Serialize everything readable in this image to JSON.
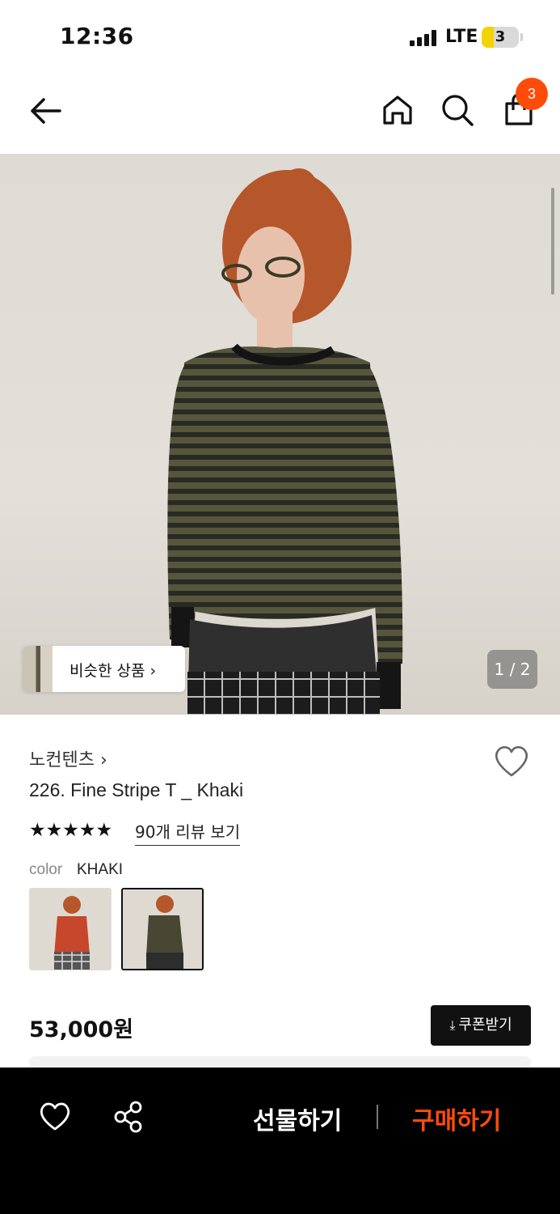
{
  "status_bar": {
    "time": "12:36",
    "network": "LTE",
    "battery": "3"
  },
  "header": {
    "icons": [
      "back-arrow-icon",
      "home-icon",
      "search-icon",
      "shopping-bag-icon"
    ],
    "cart_badge": "3",
    "accent_color": "#ff4b0a"
  },
  "gallery": {
    "similar_label": "비슷한 상품 ›",
    "page_indicator": "1 / 2"
  },
  "product": {
    "brand": "노컨텐츠 ›",
    "name": "226. Fine Stripe T _ Khaki",
    "rating_stars": "★★★★★",
    "review_link": "90개 리뷰 보기",
    "color_label": "color",
    "color_value": "KHAKI",
    "color_options": [
      "red-shirt-thumbnail",
      "khaki-shirt-thumbnail"
    ],
    "selected_option": 1,
    "price": "53,000원",
    "coupon_label": "쿠폰받기"
  },
  "bottom_bar": {
    "gift_label": "선물하기",
    "buy_label": "구매하기"
  }
}
